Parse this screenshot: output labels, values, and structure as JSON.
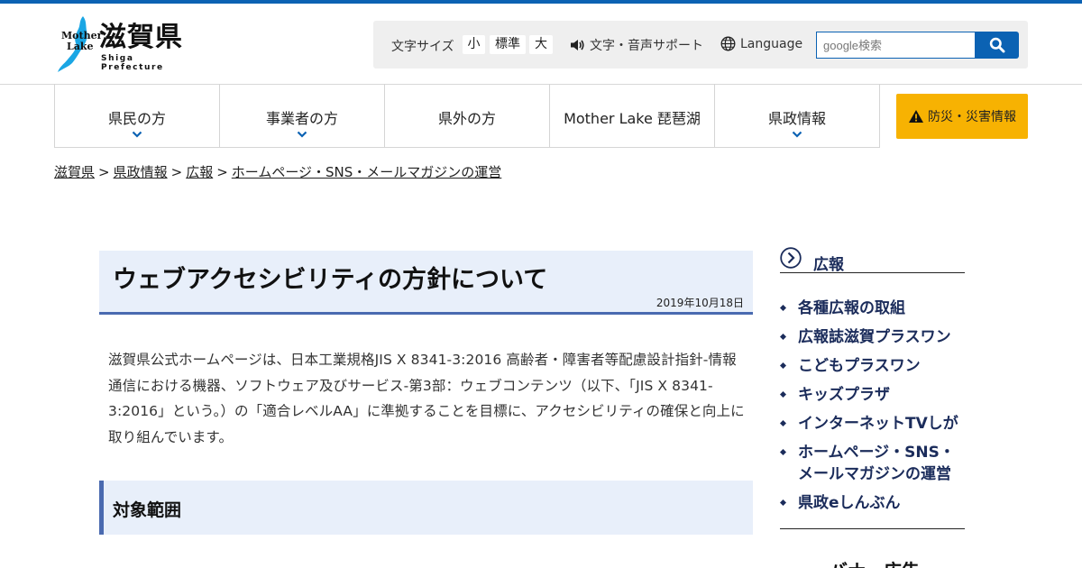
{
  "header": {
    "logo": {
      "mother": "Mother",
      "lake": "Lake",
      "name": "滋賀県",
      "en": "Shiga Prefecture"
    },
    "font_size": {
      "label": "文字サイズ",
      "small": "小",
      "normal": "標準",
      "large": "大"
    },
    "support_label": "文字・音声サポート",
    "language_label": "Language",
    "search": {
      "placeholder": "google検索"
    }
  },
  "nav": {
    "items": [
      {
        "label": "県民の方"
      },
      {
        "label": "事業者の方"
      },
      {
        "label": "県外の方"
      },
      {
        "label": "Mother Lake 琵琶湖"
      },
      {
        "label": "県政情報"
      }
    ],
    "bousai_label": "防災・災害情報"
  },
  "breadcrumb": {
    "items": [
      "滋賀県",
      "県政情報",
      "広報",
      "ホームページ・SNS・メールマガジンの運営"
    ],
    "separator": ">"
  },
  "main": {
    "title": "ウェブアクセシビリティの方針について",
    "date": "2019年10月18日",
    "intro": "滋賀県公式ホームページは、日本工業規格JIS X 8341-3:2016 高齢者・障害者等配慮設計指針-情報通信における機器、ソフトウェア及びサービス-第3部：ウェブコンテンツ（以下、「JIS X 8341-3:2016」という。）の「適合レベルAA」に準拠することを目標に、アクセシビリティの確保と向上に取り組んでいます。",
    "section_title": "対象範囲"
  },
  "side": {
    "title": "広報",
    "items": [
      "各種広報の取組",
      "広報誌滋賀プラスワン",
      "こどもプラスワン",
      "キッズプラザ",
      "インターネットTVしが",
      "ホームページ・SNS・メールマガジンの運営",
      "県政eしんぶん"
    ],
    "item_lines": {
      "5": [
        "ホームページ・SNS・",
        "メールマガジンの運営"
      ]
    },
    "banner_title": "バナー広告"
  },
  "colors": {
    "brand": "#0b62b3",
    "accent_nav": "#4a6ab0",
    "title_bg": "#e8effa",
    "bousai": "#f7b202",
    "side_text": "#1b2c5b",
    "logo_water": "#1aa6e4"
  }
}
